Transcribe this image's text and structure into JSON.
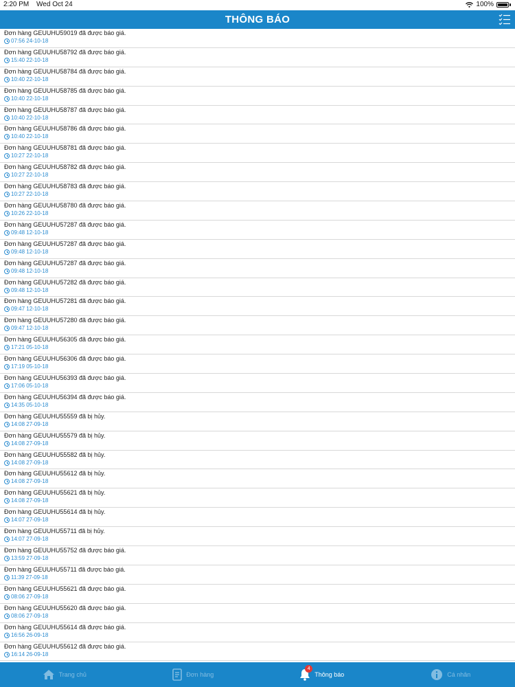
{
  "status_bar": {
    "time": "2:20 PM",
    "date": "Wed Oct 24",
    "battery": "100%"
  },
  "header": {
    "title": "THÔNG BÁO",
    "action_icon": "checklist-icon"
  },
  "notifications": [
    {
      "title": "Đơn hàng GEUUHU59019 đã được báo giá.",
      "time": "07:56 24-10-18"
    },
    {
      "title": "Đơn hàng GEUUHU58792 đã được báo giá.",
      "time": "15:40 22-10-18"
    },
    {
      "title": "Đơn hàng GEUUHU58784 đã được báo giá.",
      "time": "10:40 22-10-18"
    },
    {
      "title": "Đơn hàng GEUUHU58785 đã được báo giá.",
      "time": "10:40 22-10-18"
    },
    {
      "title": "Đơn hàng GEUUHU58787 đã được báo giá.",
      "time": "10:40 22-10-18"
    },
    {
      "title": "Đơn hàng GEUUHU58786 đã được báo giá.",
      "time": "10:40 22-10-18"
    },
    {
      "title": "Đơn hàng GEUUHU58781 đã được báo giá.",
      "time": "10:27 22-10-18"
    },
    {
      "title": "Đơn hàng GEUUHU58782 đã được báo giá.",
      "time": "10:27 22-10-18"
    },
    {
      "title": "Đơn hàng GEUUHU58783 đã được báo giá.",
      "time": "10:27 22-10-18"
    },
    {
      "title": "Đơn hàng GEUUHU58780 đã được báo giá.",
      "time": "10:26 22-10-18"
    },
    {
      "title": "Đơn hàng GEUUHU57287 đã được báo giá.",
      "time": "09:48 12-10-18"
    },
    {
      "title": "Đơn hàng GEUUHU57287 đã được báo giá.",
      "time": "09:48 12-10-18"
    },
    {
      "title": "Đơn hàng GEUUHU57287 đã được báo giá.",
      "time": "09:48 12-10-18"
    },
    {
      "title": "Đơn hàng GEUUHU57282 đã được báo giá.",
      "time": "09:48 12-10-18"
    },
    {
      "title": "Đơn hàng GEUUHU57281 đã được báo giá.",
      "time": "09:47 12-10-18"
    },
    {
      "title": "Đơn hàng GEUUHU57280 đã được báo giá.",
      "time": "09:47 12-10-18"
    },
    {
      "title": "Đơn hàng GEUUHU56305 đã được báo giá.",
      "time": "17:21 05-10-18"
    },
    {
      "title": "Đơn hàng GEUUHU56306 đã được báo giá.",
      "time": "17:19 05-10-18"
    },
    {
      "title": "Đơn hàng GEUUHU56393 đã được báo giá.",
      "time": "17:06 05-10-18"
    },
    {
      "title": "Đơn hàng GEUUHU56394 đã được báo giá.",
      "time": "14:35 05-10-18"
    },
    {
      "title": "Đơn hàng GEUUHU55559 đã bị hủy.",
      "time": "14:08 27-09-18"
    },
    {
      "title": "Đơn hàng GEUUHU55579 đã bị hủy.",
      "time": "14:08 27-09-18"
    },
    {
      "title": "Đơn hàng GEUUHU55582 đã bị hủy.",
      "time": "14:08 27-09-18"
    },
    {
      "title": "Đơn hàng GEUUHU55612 đã bị hủy.",
      "time": "14:08 27-09-18"
    },
    {
      "title": "Đơn hàng GEUUHU55621 đã bị hủy.",
      "time": "14:08 27-09-18"
    },
    {
      "title": "Đơn hàng GEUUHU55614 đã bị hủy.",
      "time": "14:07 27-09-18"
    },
    {
      "title": "Đơn hàng GEUUHU55711 đã bị hủy.",
      "time": "14:07 27-09-18"
    },
    {
      "title": "Đơn hàng GEUUHU55752 đã được báo giá.",
      "time": "13:59 27-09-18"
    },
    {
      "title": "Đơn hàng GEUUHU55711 đã được báo giá.",
      "time": "11:39 27-09-18"
    },
    {
      "title": "Đơn hàng GEUUHU55621 đã được báo giá.",
      "time": "08:06 27-09-18"
    },
    {
      "title": "Đơn hàng GEUUHU55620 đã được báo giá.",
      "time": "08:06 27-09-18"
    },
    {
      "title": "Đơn hàng GEUUHU55614 đã được báo giá.",
      "time": "16:56 26-09-18"
    },
    {
      "title": "Đơn hàng GEUUHU55612 đã được báo giá.",
      "time": "16:14 26-09-18"
    }
  ],
  "tab_bar": {
    "tabs": [
      {
        "label": "Trang chủ",
        "icon": "home-icon",
        "active": false
      },
      {
        "label": "Đơn hàng",
        "icon": "order-icon",
        "active": false
      },
      {
        "label": "Thông báo",
        "icon": "bell-icon",
        "active": true,
        "badge": "4"
      },
      {
        "label": "Cá nhân",
        "icon": "info-icon",
        "active": false
      }
    ]
  },
  "colors": {
    "primary": "#1a86c9",
    "time_text": "#2a8bd0",
    "badge": "#e53935"
  }
}
